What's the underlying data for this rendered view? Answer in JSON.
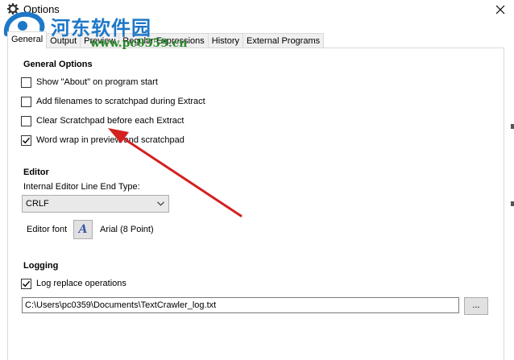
{
  "window": {
    "title": "Options",
    "close_icon": "close-icon",
    "app_icon": "gear-icon"
  },
  "watermark": {
    "text": "河东软件园",
    "url": "www.pc0359.cn"
  },
  "tabs": [
    {
      "label": "General",
      "active": true
    },
    {
      "label": "Output",
      "active": false
    },
    {
      "label": "Preview",
      "active": false
    },
    {
      "label": "Regular Expressions",
      "active": false
    },
    {
      "label": "History",
      "active": false
    },
    {
      "label": "External Programs",
      "active": false
    }
  ],
  "general_options": {
    "title": "General Options",
    "items": [
      {
        "label": "Show \"About\" on program start",
        "checked": false
      },
      {
        "label": "Add filenames to scratchpad during Extract",
        "checked": false
      },
      {
        "label": "Clear Scratchpad before each Extract",
        "checked": false
      },
      {
        "label": "Word wrap in preview and scratchpad",
        "checked": true
      }
    ]
  },
  "editor": {
    "title": "Editor",
    "line_end_label": "Internal Editor Line End Type:",
    "line_end_value": "CRLF",
    "font_label": "Editor font",
    "font_button_glyph": "A",
    "font_value": "Arial (8 Point)"
  },
  "logging": {
    "title": "Logging",
    "log_replace_label": "Log replace operations",
    "log_replace_checked": true,
    "log_path": "C:\\Users\\pc0359\\Documents\\TextCrawler_log.txt",
    "browse_label": "..."
  },
  "colors": {
    "annotation_arrow": "#d42020",
    "watermark_blue": "#1e78c8",
    "watermark_green": "#2a8a2a"
  }
}
